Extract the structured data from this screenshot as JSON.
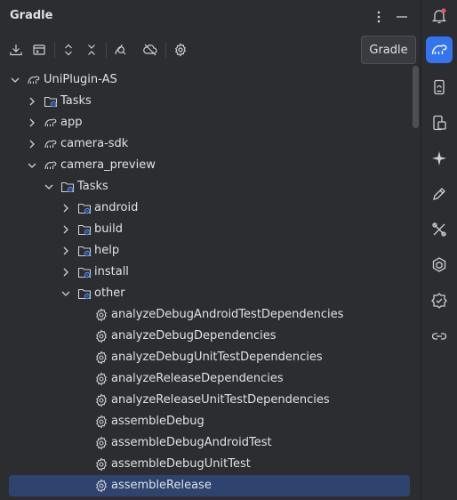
{
  "panel": {
    "title": "Gradle",
    "tooltip": "Gradle"
  },
  "header_buttons": [
    {
      "name": "more-options-icon"
    },
    {
      "name": "minimize-icon"
    }
  ],
  "toolbar": [
    {
      "name": "download-sources-icon"
    },
    {
      "name": "run-task-icon"
    },
    {
      "name": "expand-all-icon"
    },
    {
      "name": "collapse-all-icon"
    },
    {
      "name": "analyze-dependencies-icon"
    },
    {
      "name": "offline-mode-icon"
    },
    {
      "name": "gradle-settings-icon"
    }
  ],
  "tree": [
    {
      "label": "UniPlugin-AS",
      "level": 0,
      "expanded": true,
      "icon": "module-icon"
    },
    {
      "label": "Tasks",
      "level": 1,
      "expanded": false,
      "icon": "tasks-folder-icon"
    },
    {
      "label": "app",
      "level": 1,
      "expanded": false,
      "icon": "module-icon"
    },
    {
      "label": "camera-sdk",
      "level": 1,
      "expanded": false,
      "icon": "module-icon"
    },
    {
      "label": "camera_preview",
      "level": 1,
      "expanded": true,
      "icon": "module-icon"
    },
    {
      "label": "Tasks",
      "level": 2,
      "expanded": true,
      "icon": "tasks-folder-icon"
    },
    {
      "label": "android",
      "level": 3,
      "expanded": false,
      "icon": "tasks-folder-icon"
    },
    {
      "label": "build",
      "level": 3,
      "expanded": false,
      "icon": "tasks-folder-icon"
    },
    {
      "label": "help",
      "level": 3,
      "expanded": false,
      "icon": "tasks-folder-icon"
    },
    {
      "label": "install",
      "level": 3,
      "expanded": false,
      "icon": "tasks-folder-icon"
    },
    {
      "label": "other",
      "level": 3,
      "expanded": true,
      "icon": "tasks-folder-icon"
    },
    {
      "label": "analyzeDebugAndroidTestDependencies",
      "level": 4,
      "icon": "task-gear-icon"
    },
    {
      "label": "analyzeDebugDependencies",
      "level": 4,
      "icon": "task-gear-icon"
    },
    {
      "label": "analyzeDebugUnitTestDependencies",
      "level": 4,
      "icon": "task-gear-icon"
    },
    {
      "label": "analyzeReleaseDependencies",
      "level": 4,
      "icon": "task-gear-icon"
    },
    {
      "label": "analyzeReleaseUnitTestDependencies",
      "level": 4,
      "icon": "task-gear-icon"
    },
    {
      "label": "assembleDebug",
      "level": 4,
      "icon": "task-gear-icon"
    },
    {
      "label": "assembleDebugAndroidTest",
      "level": 4,
      "icon": "task-gear-icon"
    },
    {
      "label": "assembleDebugUnitTest",
      "level": 4,
      "icon": "task-gear-icon"
    },
    {
      "label": "assembleRelease",
      "level": 4,
      "icon": "task-gear-icon",
      "selected": true
    }
  ],
  "right_stripe": [
    {
      "name": "notifications-bell-icon",
      "active": false
    },
    {
      "name": "gradle-elephant-icon",
      "active": true
    },
    {
      "name": "device-manager-icon",
      "active": false
    },
    {
      "name": "running-devices-icon",
      "active": false
    },
    {
      "name": "ai-assistant-sparkle-icon",
      "active": false
    },
    {
      "name": "edit-pencil-icon",
      "active": false
    },
    {
      "name": "build-tools-icon",
      "active": false
    },
    {
      "name": "plugin-icon",
      "active": false
    },
    {
      "name": "inspection-icon",
      "active": false
    },
    {
      "name": "link-icon",
      "active": false
    }
  ],
  "colors": {
    "background": "#2b2d30",
    "selection": "#2e436e",
    "accent": "#3574f0",
    "text": "#dfe1e5",
    "icon": "#ced0d6",
    "notification_dot": "#e55765"
  }
}
